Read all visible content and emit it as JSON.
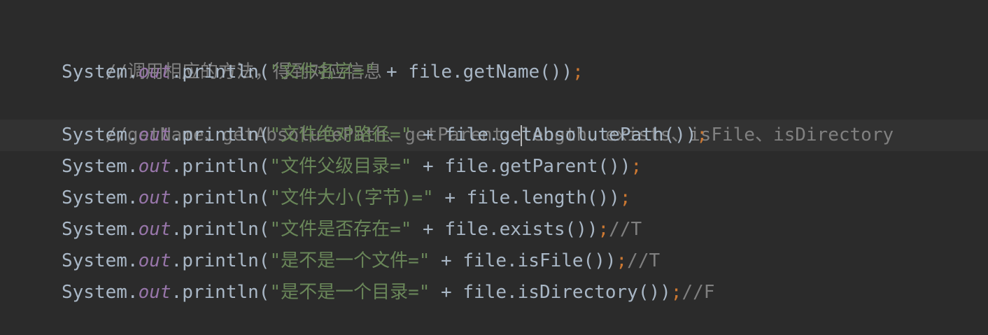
{
  "editor": {
    "theme_colors": {
      "background": "#2b2b2b",
      "current_line": "#323232",
      "comment": "#808080",
      "string": "#6a8759",
      "field": "#9876aa",
      "keyword_punct": "#cc7832",
      "default": "#a9b7c6"
    },
    "lines": [
      {
        "comment": "//调用相应的方法，得到对应信息"
      },
      {
        "class": "System",
        "dot1": ".",
        "field": "out",
        "dot2": ".println(",
        "string": "\"文件名字=\"",
        "concat": " + file.getName())",
        "semicolon": ";"
      },
      {
        "comment": "//getName、getAbsolutePath、getParent、length、exists、isFile、isDirectory"
      },
      {
        "class": "System",
        "dot1": ".",
        "field": "out",
        "dot2": ".println(",
        "string": "\"文件绝对路径=\"",
        "concat_pre": " + file.ge",
        "concat_post": "tAbsolutePath())",
        "semicolon": ";"
      },
      {
        "class": "System",
        "dot1": ".",
        "field": "out",
        "dot2": ".println(",
        "string": "\"文件父级目录=\"",
        "concat": " + file.getParent())",
        "semicolon": ";"
      },
      {
        "class": "System",
        "dot1": ".",
        "field": "out",
        "dot2": ".println(",
        "string": "\"文件大小(字节)=\"",
        "concat": " + file.length())",
        "semicolon": ";"
      },
      {
        "class": "System",
        "dot1": ".",
        "field": "out",
        "dot2": ".println(",
        "string": "\"文件是否存在=\"",
        "concat": " + file.exists())",
        "semicolon": ";",
        "trailing_comment": "//T"
      },
      {
        "class": "System",
        "dot1": ".",
        "field": "out",
        "dot2": ".println(",
        "string": "\"是不是一个文件=\"",
        "concat": " + file.isFile())",
        "semicolon": ";",
        "trailing_comment": "//T"
      },
      {
        "class": "System",
        "dot1": ".",
        "field": "out",
        "dot2": ".println(",
        "string": "\"是不是一个目录=\"",
        "concat": " + file.isDirectory())",
        "semicolon": ";",
        "trailing_comment": "//F"
      }
    ]
  }
}
